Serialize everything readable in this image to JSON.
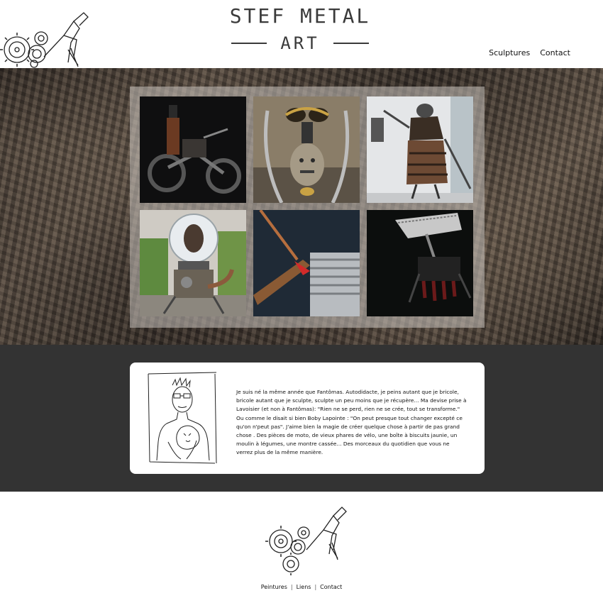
{
  "header": {
    "brand_title": "STEF METAL",
    "brand_subtitle": "ART",
    "nav": {
      "sculptures": "Sculptures",
      "contact": "Contact"
    }
  },
  "gallery": {
    "items": [
      {
        "icon": "motorcycle-sculpture-photo"
      },
      {
        "icon": "goggles-face-sculpture-photo"
      },
      {
        "icon": "lamp-figure-sculpture-photo"
      },
      {
        "icon": "glass-dome-robot-photo"
      },
      {
        "icon": "clamp-sculpture-photo"
      },
      {
        "icon": "chainsaw-creature-photo"
      }
    ]
  },
  "about": {
    "bio": "Je suis né la même année que Fantômas. Autodidacte, je peins autant que je bricole, bricole autant que je sculpte, sculpte un peu moins que je récupère... Ma devise prise à Lavoisier (et non à Fantômas): \"Rien ne se perd, rien ne se crée, tout se transforme.\" Ou comme le disait si bien Boby Lapointe : \"On peut presque tout changer excepté ce qu'on n'peut pas\". J'aime bien la magie de créer quelque chose à partir de pas grand chose . Des pièces de moto, de vieux phares de vélo, une boîte à biscuits jaunie, un moulin à légumes, une montre cassée... Des morceaux du quotidien que vous ne verrez plus de la même manière."
  },
  "footer": {
    "links": {
      "peintures": "Peintures",
      "liens": "Liens",
      "contact": "Contact"
    },
    "separator": "|"
  },
  "colors": {
    "about_bg": "#333333",
    "card_bg": "#ffffff",
    "text": "#111111"
  }
}
